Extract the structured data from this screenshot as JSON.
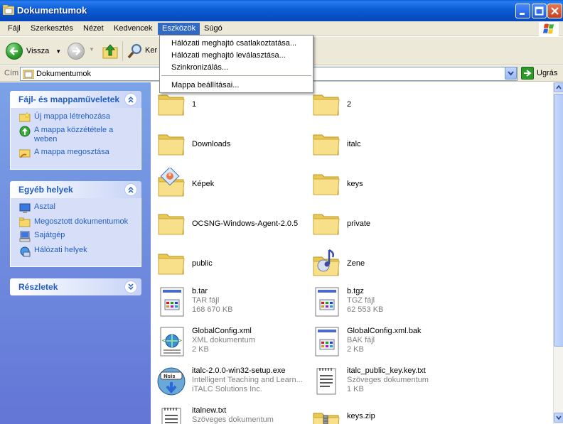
{
  "window": {
    "title": "Dokumentumok"
  },
  "menubar": {
    "items": [
      "Fájl",
      "Szerkesztés",
      "Nézet",
      "Kedvencek",
      "Eszközök",
      "Súgó"
    ]
  },
  "toolbar": {
    "back_label": "Vissza",
    "search_label_partial": "Ker"
  },
  "address": {
    "label": "Cím",
    "value": "Dokumentumok",
    "go_label": "Ugrás"
  },
  "dropdown": {
    "items": [
      "Hálózati meghajtó csatlakoztatása...",
      "Hálózati meghajtó leválasztása...",
      "Szinkronizálás...",
      "Mappa beállításai..."
    ]
  },
  "taskpane": {
    "file_tasks": {
      "title": "Fájl- és mappaműveletek",
      "items": [
        "Új mappa létrehozása",
        "A mappa közzététele a weben",
        "A mappa megosztása"
      ]
    },
    "other_places": {
      "title": "Egyéb helyek",
      "items": [
        "Asztal",
        "Megosztott dokumentumok",
        "Sajátgép",
        "Hálózati helyek"
      ]
    },
    "details": {
      "title": "Részletek"
    }
  },
  "files": [
    {
      "name": "1",
      "icon": "folder-icon"
    },
    {
      "name": "2",
      "icon": "folder-icon"
    },
    {
      "name": "Downloads",
      "icon": "folder-icon"
    },
    {
      "name": "italc",
      "icon": "folder-icon"
    },
    {
      "name": "Képek",
      "icon": "pictures-folder-icon"
    },
    {
      "name": "keys",
      "icon": "folder-icon"
    },
    {
      "name": "OCSNG-Windows-Agent-2.0.5",
      "icon": "folder-icon"
    },
    {
      "name": "private",
      "icon": "folder-icon"
    },
    {
      "name": "public",
      "icon": "folder-icon"
    },
    {
      "name": "Zene",
      "icon": "music-folder-icon"
    },
    {
      "name": "b.tar",
      "type": "TAR fájl",
      "size": "168 670 KB",
      "icon": "generic-file-icon"
    },
    {
      "name": "b.tgz",
      "type": "TGZ fájl",
      "size": "62 553 KB",
      "icon": "generic-file-icon"
    },
    {
      "name": "GlobalConfig.xml",
      "type": "XML dokumentum",
      "size": "2 KB",
      "icon": "xml-file-icon"
    },
    {
      "name": "GlobalConfig.xml.bak",
      "type": "BAK fájl",
      "size": "2 KB",
      "icon": "generic-file-icon"
    },
    {
      "name": "italc-2.0.0-win32-setup.exe",
      "type": "Intelligent Teaching and Learn...",
      "size": "iTALC Solutions Inc.",
      "icon": "installer-icon"
    },
    {
      "name": "italc_public_key.key.txt",
      "type": "Szöveges dokumentum",
      "size": "1 KB",
      "icon": "text-file-icon"
    },
    {
      "name": "italnew.txt",
      "type": "Szöveges dokumentum",
      "size": "",
      "icon": "text-file-icon"
    },
    {
      "name": "keys.zip",
      "type": "",
      "size": "",
      "icon": "zip-folder-icon"
    }
  ],
  "colors": {
    "titlebar": "#0a52c8",
    "menu_highlight": "#316ac5",
    "taskpane_bg": "#6f8ce0",
    "taskpane_link": "#215dc6"
  }
}
